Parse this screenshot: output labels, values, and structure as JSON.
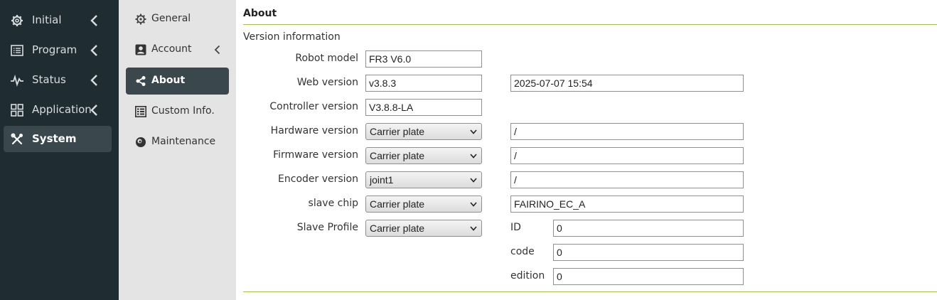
{
  "sidebar": {
    "items": [
      {
        "label": "Initial",
        "icon": "gear-icon"
      },
      {
        "label": "Program",
        "icon": "list-icon"
      },
      {
        "label": "Status",
        "icon": "pulse-icon"
      },
      {
        "label": "Application",
        "icon": "grid-icon"
      },
      {
        "label": "System",
        "icon": "tools-icon",
        "active": true
      }
    ]
  },
  "submenu": {
    "items": [
      {
        "label": "General",
        "icon": "gear-icon"
      },
      {
        "label": "Account",
        "icon": "user-card-icon"
      },
      {
        "label": "About",
        "icon": "share-icon",
        "active": true
      },
      {
        "label": "Custom Info.",
        "icon": "table-icon"
      },
      {
        "label": "Maintenance",
        "icon": "maintenance-icon"
      }
    ]
  },
  "main": {
    "title": "About",
    "section": "Version information",
    "robot_model": {
      "label": "Robot model",
      "value": "FR3 V6.0"
    },
    "web_version": {
      "label": "Web version",
      "value": "v3.8.3",
      "date": "2025-07-07 15:54"
    },
    "controller_version": {
      "label": "Controller version",
      "value": "V3.8.8-LA"
    },
    "hardware_version": {
      "label": "Hardware version",
      "select": "Carrier plate",
      "value": "/"
    },
    "firmware_version": {
      "label": "Firmware version",
      "select": "Carrier plate",
      "value": "/"
    },
    "encoder_version": {
      "label": "Encoder version",
      "select": "joint1",
      "value": "/"
    },
    "slave_chip": {
      "label": "slave chip",
      "select": "Carrier plate",
      "value": "FAIRINO_EC_A"
    },
    "slave_profile": {
      "label": "Slave Profile",
      "select": "Carrier plate",
      "id_label": "ID",
      "id_value": "0",
      "code_label": "code",
      "code_value": "0",
      "edition_label": "edition",
      "edition_value": "0"
    }
  },
  "colors": {
    "sidebar_bg": "#1f2d33",
    "active_bg": "#3a474d",
    "submenu_bg": "#e4e4e4",
    "accent_line": "#a5bf4f"
  }
}
